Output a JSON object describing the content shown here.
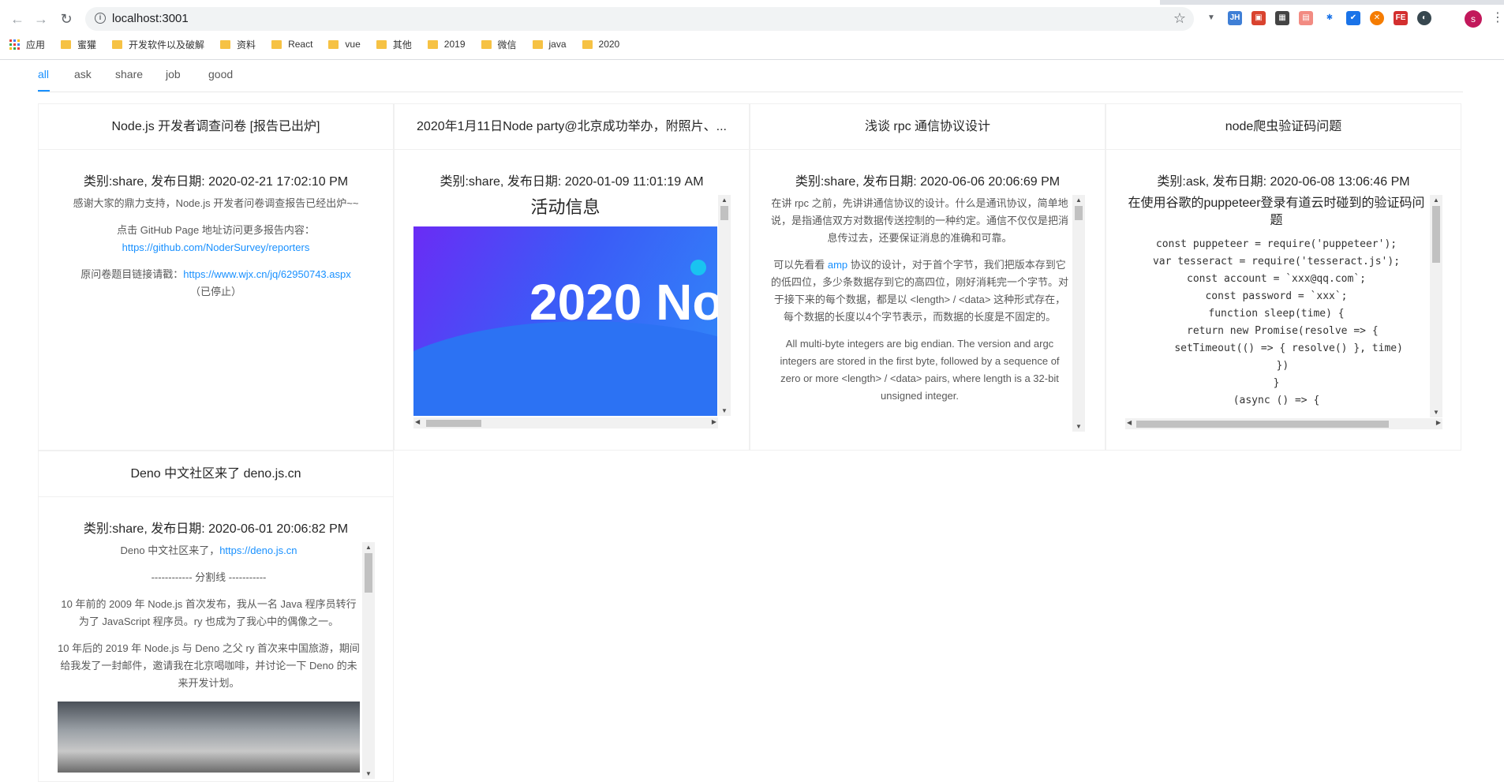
{
  "browser": {
    "url": "localhost:3001",
    "bookmarks": [
      "应用",
      "蜜獾",
      "开发软件以及破解",
      "资料",
      "React",
      "vue",
      "其他",
      "2019",
      "微信",
      "java",
      "2020"
    ],
    "profile_initial": "s"
  },
  "tabs": [
    "all",
    "ask",
    "share",
    "job",
    "good"
  ],
  "active_tab": "all",
  "cards": [
    {
      "title": "Node.js 开发者调查问卷 [报告已出炉]",
      "meta": "类别:share, 发布日期: 2020-02-21 17:02:10 PM",
      "p1": "感谢大家的鼎力支持，Node.js 开发者问卷调查报告已经出炉~~",
      "p2": "点击 GitHub Page 地址访问更多报告内容：",
      "link1": "https://github.com/NoderSurvey/reporters",
      "p3": "原问卷题目链接请戳：",
      "link2": "https://www.wjx.cn/jq/62950743.aspx",
      "p3b": "（已停止）"
    },
    {
      "title": "2020年1月11日Node party@北京成功举办，附照片、...",
      "meta": "类别:share, 发布日期: 2020-01-09 11:01:19 AM",
      "heading": "活动信息",
      "banner_text": "2020 No"
    },
    {
      "title": "浅谈 rpc 通信协议设计",
      "meta": "类别:share, 发布日期: 2020-06-06 20:06:69 PM",
      "p1": "在讲 rpc 之前，先讲讲通信协议的设计。什么是通讯协议，简单地说，是指通信双方对数据传送控制的一种约定。通信不仅仅是把消息传过去，还要保证消息的准确和可靠。",
      "p2a": "可以先看看 ",
      "p2link": "amp",
      "p2b": " 协议的设计，对于首个字节，我们把版本存到它的低四位，多少条数据存到它的高四位，刚好消耗完一个字节。对于接下来的每个数据，都是以 <length> / <data> 这种形式存在，每个数据的长度以4个字节表示，而数据的长度是不固定的。",
      "p3": "All multi-byte integers are big endian. The version and argc integers are stored in the first byte, followed by a sequence of zero or more <length> / <data> pairs, where length is a 32-bit unsigned integer."
    },
    {
      "title": "node爬虫验证码问题",
      "meta": "类别:ask, 发布日期: 2020-06-08 13:06:46 PM",
      "heading": "在使用谷歌的puppeteer登录有道云时碰到的验证码问题",
      "code": [
        "const puppeteer = require('puppeteer');",
        "var tesseract = require('tesseract.js');",
        "const account = `xxx@qq.com`;",
        "const password = `xxx`;",
        "function sleep(time) {",
        "  return new Promise(resolve => {",
        "    setTimeout(() => { resolve() }, time)",
        "  })",
        "}",
        "(async () => {"
      ]
    },
    {
      "title": "Deno 中文社区来了 deno.js.cn",
      "meta": "类别:share, 发布日期: 2020-06-01 20:06:82 PM",
      "p1": "Deno 中文社区来了，",
      "link1": "https://deno.js.cn",
      "p2": "------------ 分割线 -----------",
      "p3": "10 年前的 2009 年 Node.js 首次发布，我从一名 Java 程序员转行为了 JavaScript 程序员。ry 也成为了我心中的偶像之一。",
      "p4": "10 年后的 2019 年 Node.js 与 Deno 之父 ry 首次来中国旅游，期间给我发了一封邮件，邀请我在北京喝咖啡，并讨论一下 Deno 的未来开发计划。"
    }
  ]
}
